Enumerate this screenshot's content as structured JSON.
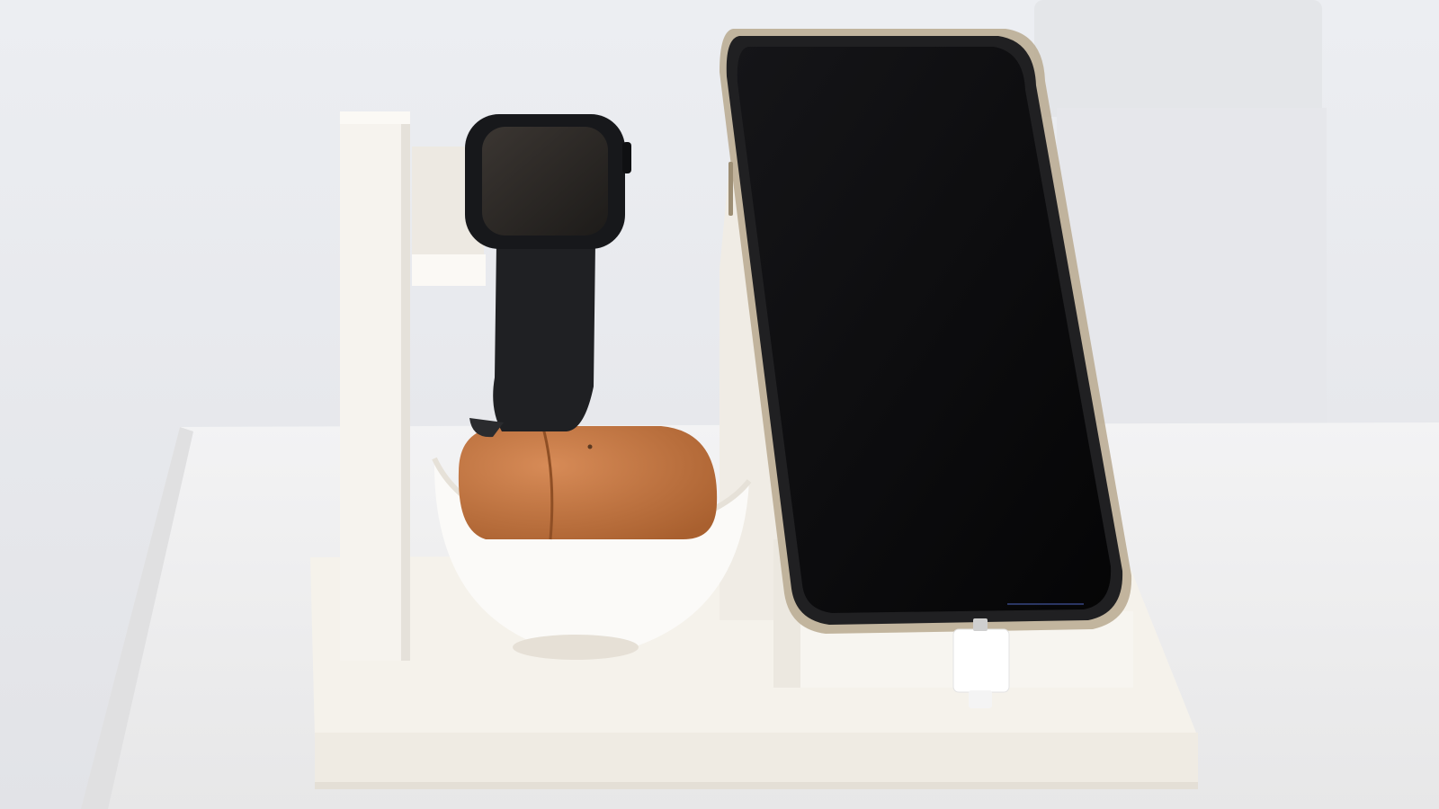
{
  "scene": {
    "description_visible_text": "",
    "objects": [
      {
        "name": "charging-stand",
        "color": "#f4f1ea"
      },
      {
        "name": "smartwatch",
        "color": "#1b1c1f"
      },
      {
        "name": "earbuds-case",
        "color": "#c77a45"
      },
      {
        "name": "smartphone",
        "color": "#0b0b0d"
      },
      {
        "name": "charging-cable",
        "color": "#ffffff"
      }
    ]
  },
  "colors": {
    "wall": "#e9eaee",
    "table": "#f2f2f2",
    "stand": "#f4f1ea",
    "watch": "#1b1c1f",
    "case": "#c77a45",
    "phone_screen": "#0b0b0d",
    "phone_frame": "#b9a98d"
  }
}
